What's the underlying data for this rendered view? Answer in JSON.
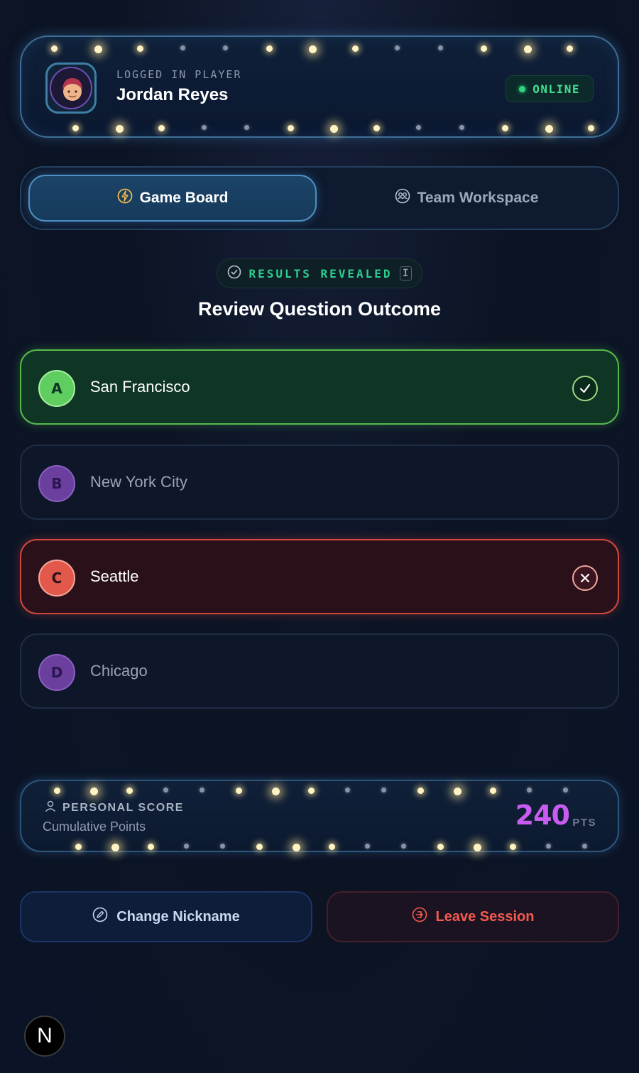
{
  "player": {
    "label": "LOGGED IN PLAYER",
    "name": "Jordan Reyes",
    "status": "ONLINE"
  },
  "tabs": [
    {
      "label": "Game Board",
      "icon": "lightning-icon",
      "active": true
    },
    {
      "label": "Team Workspace",
      "icon": "team-icon",
      "active": false
    }
  ],
  "results": {
    "badge": "RESULTS REVEALED",
    "title": "Review Question Outcome"
  },
  "options": [
    {
      "letter": "A",
      "text": "San Francisco",
      "state": "correct"
    },
    {
      "letter": "B",
      "text": "New York City",
      "state": "neutral"
    },
    {
      "letter": "C",
      "text": "Seattle",
      "state": "wrong"
    },
    {
      "letter": "D",
      "text": "Chicago",
      "state": "neutral"
    }
  ],
  "score": {
    "label": "PERSONAL SCORE",
    "sublabel": "Cumulative Points",
    "value": "240",
    "unit": "PTS"
  },
  "actions": {
    "nickname": "Change Nickname",
    "leave": "Leave Session"
  },
  "colors": {
    "correct": "#58b94a",
    "wrong": "#d3473e",
    "accent": "#c85cf0",
    "online": "#3fe08f"
  },
  "logo": "N"
}
